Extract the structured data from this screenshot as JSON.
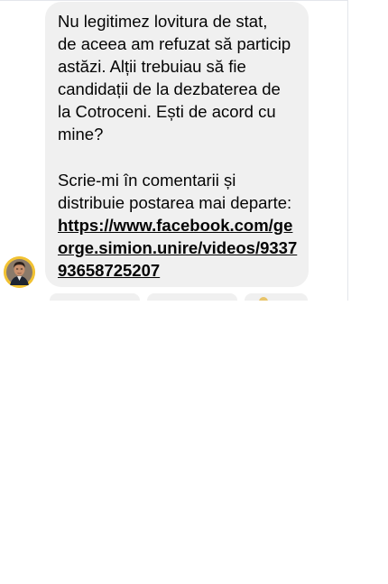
{
  "message": {
    "lines": [
      "Nu legitimez lovitura de stat,",
      "de aceea am refuzat să particip",
      "astăzi. Alții trebuiau să fie",
      "candidații de la dezbaterea de",
      "la Cotroceni. Ești de acord cu",
      "mine?"
    ],
    "lines2": [
      "Scrie-mi în comentarii și",
      "distribuie postarea mai departe:"
    ],
    "link_lines": [
      "https://www.facebook.com/ge",
      "orge.simion.unire/videos/9337",
      "93658725207"
    ],
    "bubble_color": "#f0f0f0",
    "text_color": "#050505"
  },
  "avatar": {
    "icon": "person-avatar",
    "ring_color": "#f2c232"
  }
}
